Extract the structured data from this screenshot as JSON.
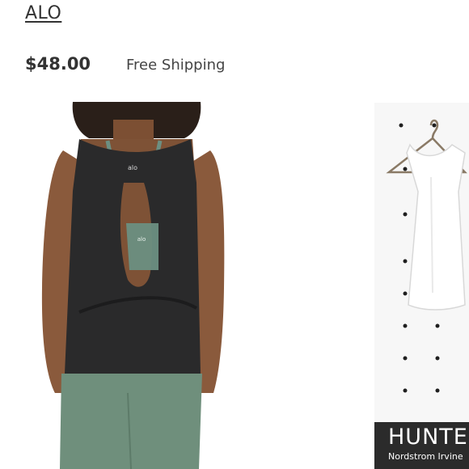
{
  "listing": {
    "brand": "ALO",
    "price": "$48.00",
    "shipping": "Free Shipping"
  },
  "gallery": {
    "main_logo_top": "alo",
    "main_logo_bra": "alo",
    "secondary_banner_title": "HUNTE",
    "secondary_banner_subtitle": "Nordstrom Irvine"
  },
  "colors": {
    "text": "#333333",
    "tank": "#2a2a2b",
    "skin": "#8a5a3c",
    "leggings": "#6f8f7c",
    "bra": "#6c8f82",
    "banner": "#2b2b2b"
  }
}
